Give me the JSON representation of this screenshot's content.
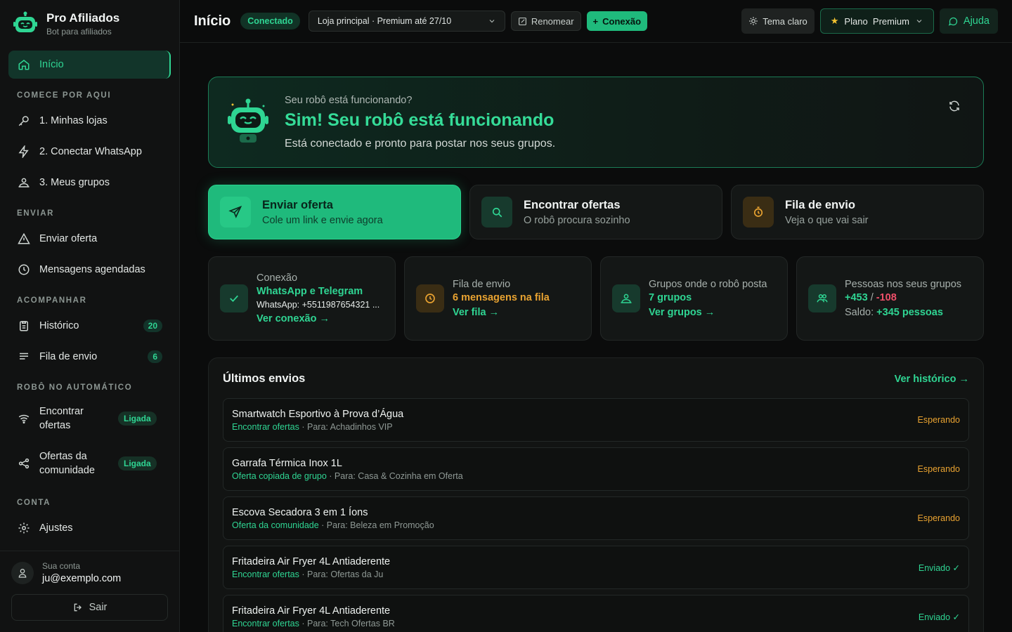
{
  "brand": {
    "title": "Pro Afiliados",
    "subtitle": "Bot para afiliados"
  },
  "sidebar": {
    "home": {
      "label": "Início",
      "icon": "home-icon"
    },
    "sections": [
      {
        "label": "COMECE POR AQUI"
      },
      {
        "label": "ENVIAR"
      },
      {
        "label": "ACOMPANHAR"
      },
      {
        "label": "ROBÔ NO AUTOMÁTICO"
      },
      {
        "label": "CONTA"
      }
    ],
    "items": [
      {
        "label": "1. Minhas lojas",
        "icon": "key-icon"
      },
      {
        "label": "2. Conectar WhatsApp",
        "icon": "bolt-icon"
      },
      {
        "label": "3. Meus grupos",
        "icon": "users-icon"
      },
      {
        "label": "Enviar oferta",
        "icon": "warning-triangle-icon"
      },
      {
        "label": "Mensagens agendadas",
        "icon": "clock-icon"
      },
      {
        "label": "Histórico",
        "icon": "clipboard-icon",
        "count": "20"
      },
      {
        "label": "Fila de envio",
        "icon": "list-icon",
        "count": "6"
      },
      {
        "label": "Encontrar ofertas",
        "icon": "wifi-icon",
        "badge": "Ligada"
      },
      {
        "label": "Ofertas da comunidade",
        "icon": "share-icon",
        "badge": "Ligada"
      },
      {
        "label": "Ajustes",
        "icon": "gear-icon"
      }
    ],
    "account": {
      "label": "Sua conta",
      "email": "ju@exemplo.com",
      "logout": "Sair"
    }
  },
  "topbar": {
    "title": "Início",
    "status": "Conectado",
    "store_select": "Loja principal · Premium até 27/10",
    "rename": "Renomear",
    "connection": "Conexão",
    "theme": "Tema claro",
    "plan": "Plano  Premium",
    "help": "Ajuda"
  },
  "hero": {
    "question": "Seu robô está funcionando?",
    "title": "Sim! Seu robô está funcionando",
    "desc": "Está conectado e pronto para postar nos seus grupos."
  },
  "actions": [
    {
      "title": "Enviar oferta",
      "sub": "Cole um link e envie agora"
    },
    {
      "title": "Encontrar ofertas",
      "sub": "O robô procura sozinho"
    },
    {
      "title": "Fila de envio",
      "sub": "Veja o que vai sair"
    }
  ],
  "stats": {
    "connection": {
      "label": "Conexão",
      "value": "WhatsApp e Telegram",
      "extra": "WhatsApp: +5511987654321 ...",
      "link": "Ver conexão →"
    },
    "queue": {
      "label": "Fila de envio",
      "value": "6 mensagens na fila",
      "link": "Ver fila →"
    },
    "groups": {
      "label": "Grupos onde o robô posta",
      "value": "7 grupos",
      "link": "Ver grupos →"
    },
    "people": {
      "label": "Pessoas nos seus grupos",
      "plus": "+453",
      "sep": " / ",
      "minus": "-108",
      "balance_label": "Saldo: ",
      "balance": "+345 pessoas"
    }
  },
  "recent": {
    "title": "Últimos envios",
    "link": "Ver histórico →",
    "rows": [
      {
        "title": "Smartwatch Esportivo à Prova d’Água",
        "source": "Encontrar ofertas",
        "dest": " · Para: Achadinhos VIP",
        "status": "Esperando"
      },
      {
        "title": "Garrafa Térmica Inox 1L",
        "source": "Oferta copiada de grupo",
        "dest": " · Para: Casa & Cozinha em Oferta",
        "status": "Esperando"
      },
      {
        "title": "Escova Secadora 3 em 1 Íons",
        "source": "Oferta da comunidade",
        "dest": " · Para: Beleza em Promoção",
        "status": "Esperando"
      },
      {
        "title": "Fritadeira Air Fryer 4L Antiaderente",
        "source": "Encontrar ofertas",
        "dest": " · Para: Ofertas da Ju",
        "status": "Enviado ✓"
      },
      {
        "title": "Fritadeira Air Fryer 4L Antiaderente",
        "source": "Encontrar ofertas",
        "dest": " · Para: Tech Ofertas BR",
        "status": "Enviado ✓"
      }
    ]
  },
  "colors": {
    "accent": "#2fd593",
    "primary_button": "#1fba7c",
    "warning": "#e9a331",
    "negative": "#f0506a",
    "background": "#0b0c0c"
  }
}
